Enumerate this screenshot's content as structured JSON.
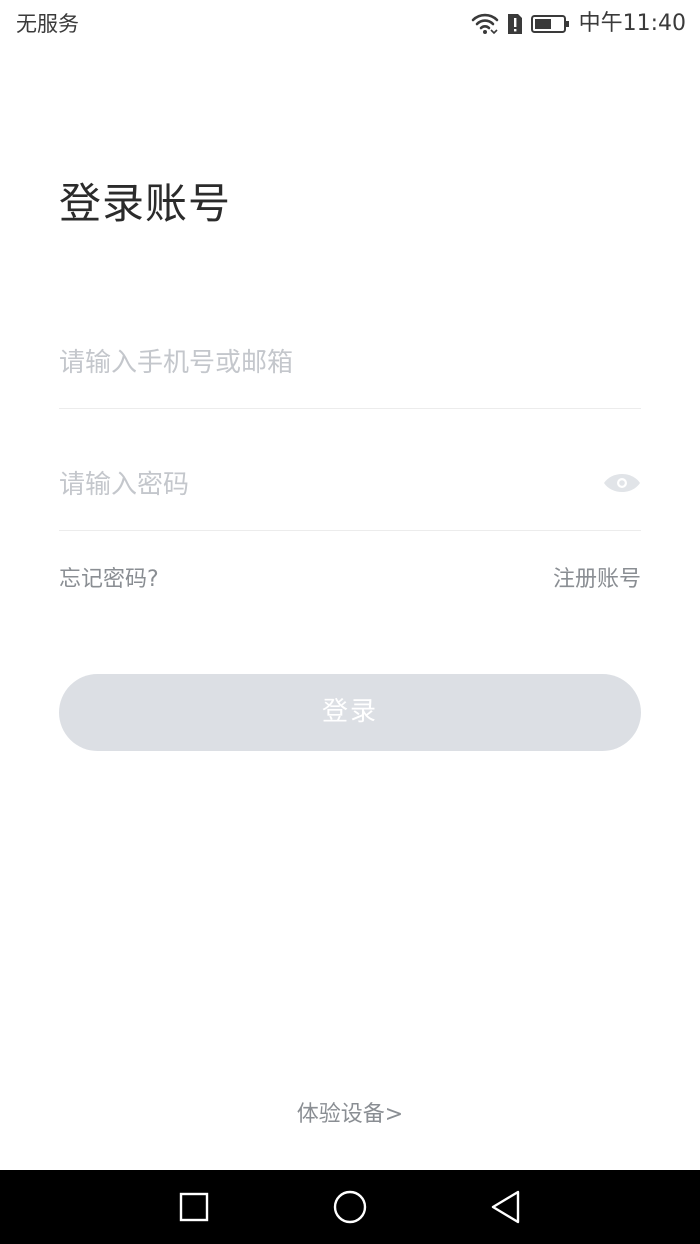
{
  "status_bar": {
    "carrier": "无服务",
    "time": "中午11:40",
    "icons": [
      "wifi-icon",
      "sim-alert-icon",
      "battery-icon"
    ]
  },
  "login": {
    "title": "登录账号",
    "phone_placeholder": "请输入手机号或邮箱",
    "password_placeholder": "请输入密码",
    "forgot_password": "忘记密码?",
    "register": "注册账号",
    "login_button": "登录",
    "demo_device": "体验设备>"
  },
  "nav_bar": {
    "icons": [
      "recent-apps-icon",
      "home-icon",
      "back-icon"
    ]
  },
  "colors": {
    "button_disabled": "#dcdfe4",
    "placeholder": "#c4c7cc",
    "link": "#8a8e93",
    "title": "#2b2b2b"
  }
}
